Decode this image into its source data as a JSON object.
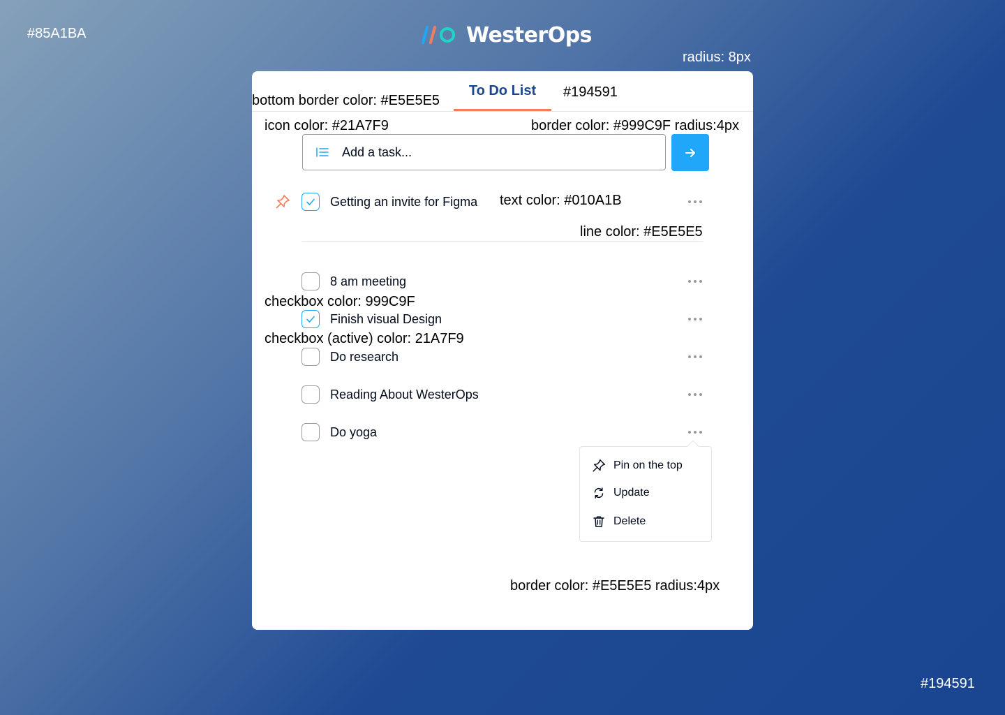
{
  "canvas_notes": {
    "bg_gradient_start": "#85A1BA",
    "radius": "radius: 8px",
    "bg_gradient_end": "#194591"
  },
  "brand": {
    "name": "WesterOps",
    "logo_icon": "westerops-logo-icon"
  },
  "tabs": [
    {
      "label": "To Do List",
      "active": true
    }
  ],
  "annotations": {
    "tab_bottom_border": "bottom border color: #E5E5E5",
    "tab_color": "#194591",
    "icon_color": "icon color: #21A7F9",
    "input_border": "border color: #999C9F radius:4px",
    "text_color": "text color: #010A1B",
    "line_color": "line color: #E5E5E5",
    "checkbox_color": "checkbox color: 999C9F",
    "checkbox_active_color": "checkbox (active) color: 21A7F9",
    "menu_border": "border color: #E5E5E5 radius:4px"
  },
  "input": {
    "placeholder": "Add a task...",
    "value": "",
    "icon": "list-icon",
    "submit_icon": "arrow-right-icon"
  },
  "tasks": [
    {
      "text": "Getting an invite for Figma",
      "checked": true,
      "pinned": true
    },
    {
      "text": "8 am meeting",
      "checked": false,
      "pinned": false
    },
    {
      "text": "Finish visual Design",
      "checked": true,
      "pinned": false
    },
    {
      "text": "Do research",
      "checked": false,
      "pinned": false
    },
    {
      "text": "Reading About WesterOps",
      "checked": false,
      "pinned": false
    },
    {
      "text": "Do yoga",
      "checked": false,
      "pinned": false
    }
  ],
  "context_menu": {
    "items": [
      {
        "label": "Pin on the top",
        "icon": "pin-icon"
      },
      {
        "label": "Update",
        "icon": "refresh-icon"
      },
      {
        "label": "Delete",
        "icon": "trash-icon"
      }
    ]
  },
  "colors": {
    "primary": "#194591",
    "accent": "#21A7F9",
    "tab_underline": "#F37E5E",
    "text": "#010A1B",
    "border": "#999C9F",
    "line": "#E5E5E5"
  }
}
